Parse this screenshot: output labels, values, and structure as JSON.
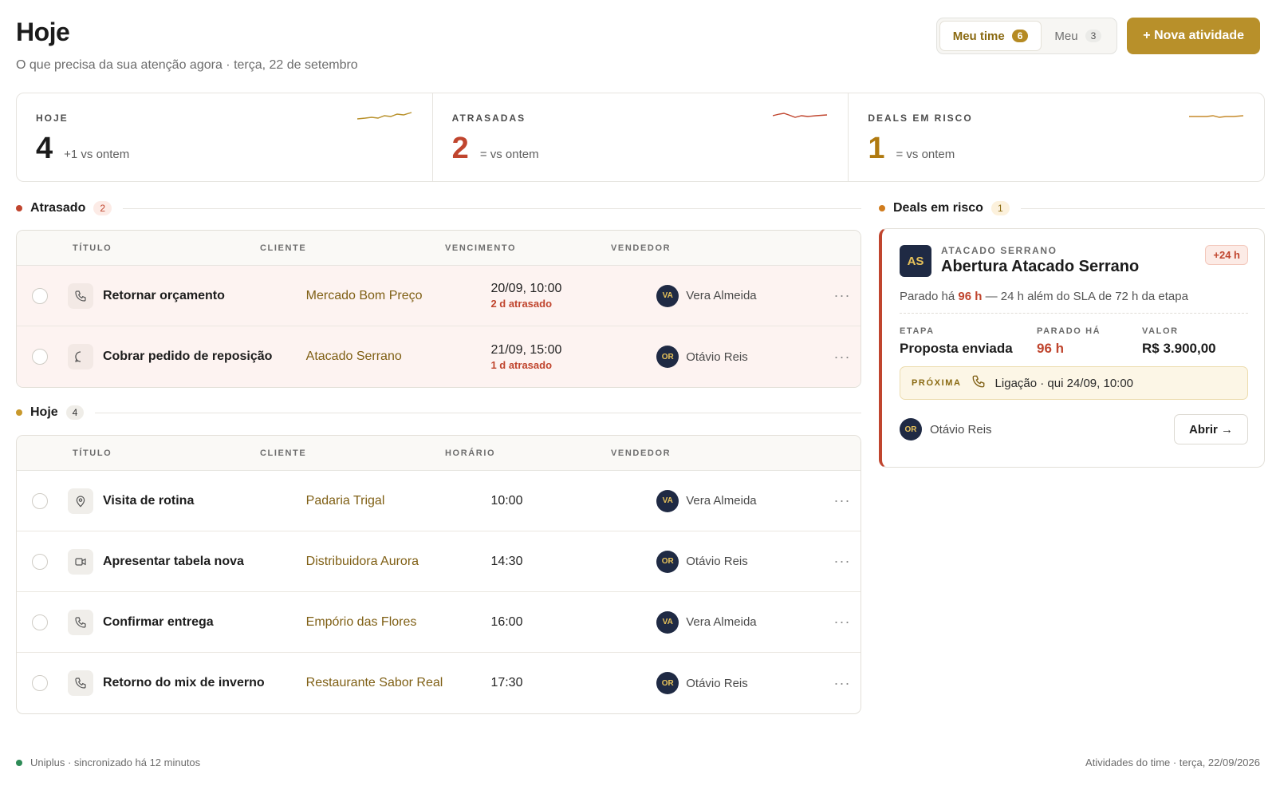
{
  "header": {
    "title": "Hoje",
    "subtitle": "O que precisa da sua atenção agora · terça, 22 de setembro",
    "segments": [
      {
        "label": "Meu time",
        "count": "6"
      },
      {
        "label": "Meu",
        "count": "3"
      }
    ],
    "primary_button": "+ Nova atividade"
  },
  "kpis": [
    {
      "label": "HOJE",
      "value": "4",
      "delta": "+1 vs ontem",
      "color": "#1b1b1b"
    },
    {
      "label": "ATRASADAS",
      "value": "2",
      "delta": "= vs ontem",
      "color": "#c0452e"
    },
    {
      "label": "DEALS EM RISCO",
      "value": "1",
      "delta": "= vs ontem",
      "color": "#b07a10"
    }
  ],
  "overdue": {
    "title": "Atrasado",
    "count": "2",
    "columns": {
      "title": "TÍTULO",
      "client": "CLIENTE",
      "due": "VENCIMENTO",
      "seller": "VENDEDOR"
    },
    "rows": [
      {
        "icon": "phone-icon",
        "title": "Retornar orçamento",
        "client": "Mercado Bom Preço",
        "due": "20/09, 10:00",
        "late": "2 d atrasado",
        "seller_initials": "VA",
        "seller": "Vera Almeida",
        "more": "···"
      },
      {
        "icon": "chat-icon",
        "title": "Cobrar pedido de reposição",
        "client": "Atacado Serrano",
        "due": "21/09, 15:00",
        "late": "1 d atrasado",
        "seller_initials": "OR",
        "seller": "Otávio Reis",
        "more": "···"
      }
    ]
  },
  "today": {
    "title": "Hoje",
    "count": "4",
    "columns": {
      "title": "TÍTULO",
      "client": "CLIENTE",
      "time": "HORÁRIO",
      "seller": "VENDEDOR"
    },
    "rows": [
      {
        "icon": "location-pin-icon",
        "title": "Visita de rotina",
        "client": "Padaria Trigal",
        "time": "10:00",
        "seller_initials": "VA",
        "seller": "Vera Almeida",
        "more": "···"
      },
      {
        "icon": "video-icon",
        "title": "Apresentar tabela nova",
        "client": "Distribuidora Aurora",
        "time": "14:30",
        "seller_initials": "OR",
        "seller": "Otávio Reis",
        "more": "···"
      },
      {
        "icon": "phone-icon",
        "title": "Confirmar entrega",
        "client": "Empório das Flores",
        "time": "16:00",
        "seller_initials": "VA",
        "seller": "Vera Almeida",
        "more": "···"
      },
      {
        "icon": "phone-icon",
        "title": "Retorno do mix de inverno",
        "client": "Restaurante Sabor Real",
        "time": "17:30",
        "seller_initials": "OR",
        "seller": "Otávio Reis",
        "more": "···"
      }
    ]
  },
  "deals": {
    "title": "Deals em risco",
    "count": "1",
    "card": {
      "logo": "AS",
      "company": "ATACADO SERRANO",
      "name": "Abertura Atacado Serrano",
      "badge": "+24 h",
      "desc_prefix": "Parado há",
      "desc_highlight": "96 h",
      "desc_suffix": "— 24 h além do SLA de 72 h da etapa",
      "stage_label": "ETAPA",
      "stage_value": "Proposta enviada",
      "stalled_label": "PARADO HÁ",
      "stalled_value": "96 h",
      "value_label": "VALOR",
      "value_value": "R$ 3.900,00",
      "next_label": "PRÓXIMA",
      "next_text": "Ligação · qui 24/09, 10:00",
      "owner_initials": "OR",
      "owner": "Otávio Reis",
      "open_button": "Abrir →"
    }
  },
  "footer": {
    "left": "Uniplus · sincronizado há 12 minutos",
    "right": "Atividades do time · terça, 22/09/2026"
  },
  "colors": {
    "accent": "#b8902a",
    "danger": "#c0452e",
    "navy": "#1f2a44"
  }
}
